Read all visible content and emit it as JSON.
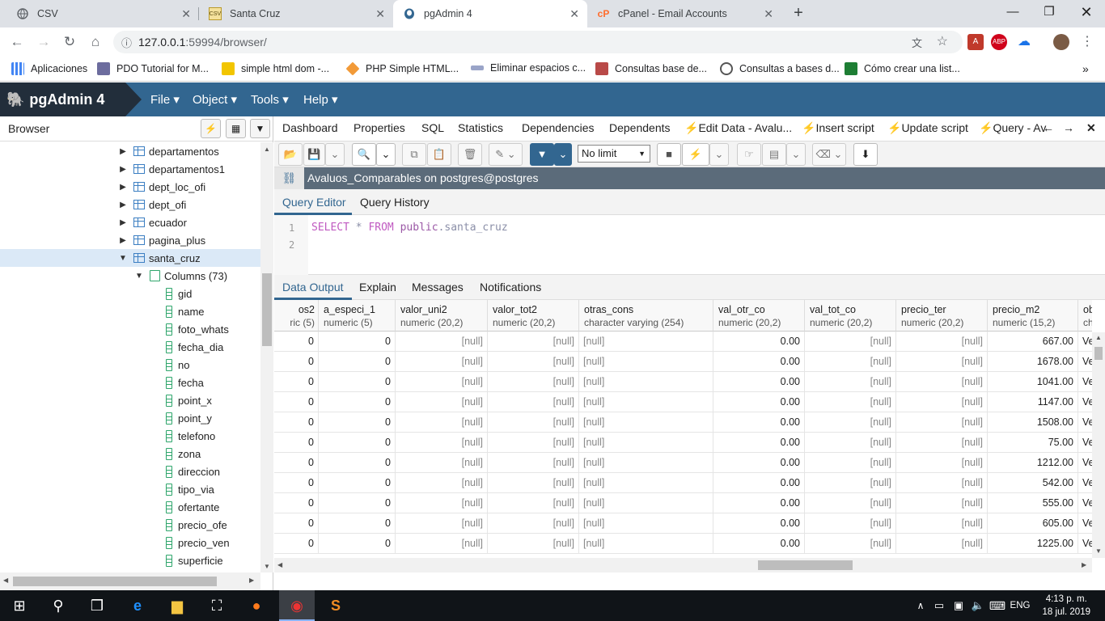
{
  "tabs": [
    {
      "title": "CSV",
      "icon": "globe-icon",
      "active": false
    },
    {
      "title": "Santa Cruz",
      "icon": "csv-file-icon",
      "active": false
    },
    {
      "title": "pgAdmin 4",
      "icon": "elephant-icon",
      "active": true
    },
    {
      "title": "cPanel - Email Accounts",
      "icon": "cpanel-icon",
      "active": false
    }
  ],
  "address": {
    "host": "127.0.0.1",
    "path": ":59994/browser/"
  },
  "bookmarks": [
    {
      "label": "Aplicaciones"
    },
    {
      "label": "PDO Tutorial for M..."
    },
    {
      "label": "simple html dom -..."
    },
    {
      "label": "PHP Simple HTML..."
    },
    {
      "label": "Eliminar espacios c..."
    },
    {
      "label": "Consultas base de..."
    },
    {
      "label": "Consultas a bases d..."
    },
    {
      "label": "Cómo crear una list..."
    }
  ],
  "pgadmin": {
    "logo": "pgAdmin 4",
    "menus": [
      "File",
      "Object",
      "Tools",
      "Help"
    ]
  },
  "browser": {
    "title": "Browser",
    "tables": [
      "departamentos",
      "departamentos1",
      "dept_loc_ofi",
      "dept_ofi",
      "ecuador",
      "pagina_plus",
      "santa_cruz"
    ],
    "columns_label": "Columns (73)",
    "columns": [
      "gid",
      "name",
      "foto_whats",
      "fecha_dia",
      "no",
      "fecha",
      "point_x",
      "point_y",
      "telefono",
      "zona",
      "direccion",
      "tipo_via",
      "ofertante",
      "precio_ofe",
      "precio_ven",
      "superficie"
    ]
  },
  "main_tabs": [
    "Dashboard",
    "Properties",
    "SQL",
    "Statistics",
    "Dependencies",
    "Dependents",
    "Edit Data - Avalu...",
    "Insert script",
    "Update script",
    "Query - Av"
  ],
  "toolbar": {
    "limit": "No limit"
  },
  "connection": {
    "title": "Avaluos_Comparables on postgres@postgres"
  },
  "editor_tabs": [
    "Query Editor",
    "Query History"
  ],
  "editor": {
    "line_numbers": [
      "1",
      "2"
    ],
    "kw1": "SELECT",
    "star": " * ",
    "kw2": "FROM",
    "schema": " public",
    "dot_table": ".santa_cruz"
  },
  "output_tabs": [
    "Data Output",
    "Explain",
    "Messages",
    "Notifications"
  ],
  "grid": {
    "columns": [
      {
        "name": "os2",
        "type": "ric (5)"
      },
      {
        "name": "a_especi_1",
        "type": "numeric (5)"
      },
      {
        "name": "valor_uni2",
        "type": "numeric (20,2)"
      },
      {
        "name": "valor_tot2",
        "type": "numeric (20,2)"
      },
      {
        "name": "otras_cons",
        "type": "character varying (254)"
      },
      {
        "name": "val_otr_co",
        "type": "numeric (20,2)"
      },
      {
        "name": "val_tot_co",
        "type": "numeric (20,2)"
      },
      {
        "name": "precio_ter",
        "type": "numeric (20,2)"
      },
      {
        "name": "precio_m2",
        "type": "numeric (15,2)"
      },
      {
        "name": "obse",
        "type": "chara"
      }
    ],
    "rows": [
      [
        "0",
        "0",
        "[null]",
        "[null]",
        "[null]",
        "0.00",
        "[null]",
        "[null]",
        "667.00",
        "Ve"
      ],
      [
        "0",
        "0",
        "[null]",
        "[null]",
        "[null]",
        "0.00",
        "[null]",
        "[null]",
        "1678.00",
        "Ve"
      ],
      [
        "0",
        "0",
        "[null]",
        "[null]",
        "[null]",
        "0.00",
        "[null]",
        "[null]",
        "1041.00",
        "Ve"
      ],
      [
        "0",
        "0",
        "[null]",
        "[null]",
        "[null]",
        "0.00",
        "[null]",
        "[null]",
        "1147.00",
        "Ve"
      ],
      [
        "0",
        "0",
        "[null]",
        "[null]",
        "[null]",
        "0.00",
        "[null]",
        "[null]",
        "1508.00",
        "Ve"
      ],
      [
        "0",
        "0",
        "[null]",
        "[null]",
        "[null]",
        "0.00",
        "[null]",
        "[null]",
        "75.00",
        "Ve"
      ],
      [
        "0",
        "0",
        "[null]",
        "[null]",
        "[null]",
        "0.00",
        "[null]",
        "[null]",
        "1212.00",
        "Ve"
      ],
      [
        "0",
        "0",
        "[null]",
        "[null]",
        "[null]",
        "0.00",
        "[null]",
        "[null]",
        "542.00",
        "Ve"
      ],
      [
        "0",
        "0",
        "[null]",
        "[null]",
        "[null]",
        "0.00",
        "[null]",
        "[null]",
        "555.00",
        "Ve"
      ],
      [
        "0",
        "0",
        "[null]",
        "[null]",
        "[null]",
        "0.00",
        "[null]",
        "[null]",
        "605.00",
        "Ve"
      ],
      [
        "0",
        "0",
        "[null]",
        "[null]",
        "[null]",
        "0.00",
        "[null]",
        "[null]",
        "1225.00",
        "Ve"
      ]
    ]
  },
  "taskbar": {
    "time": "4:13 p. m.",
    "date": "18 jul. 2019",
    "lang": "ENG"
  },
  "colors": {
    "pg_blue": "#326690",
    "pg_dark": "#222e3b",
    "taskbar": "#101418"
  }
}
